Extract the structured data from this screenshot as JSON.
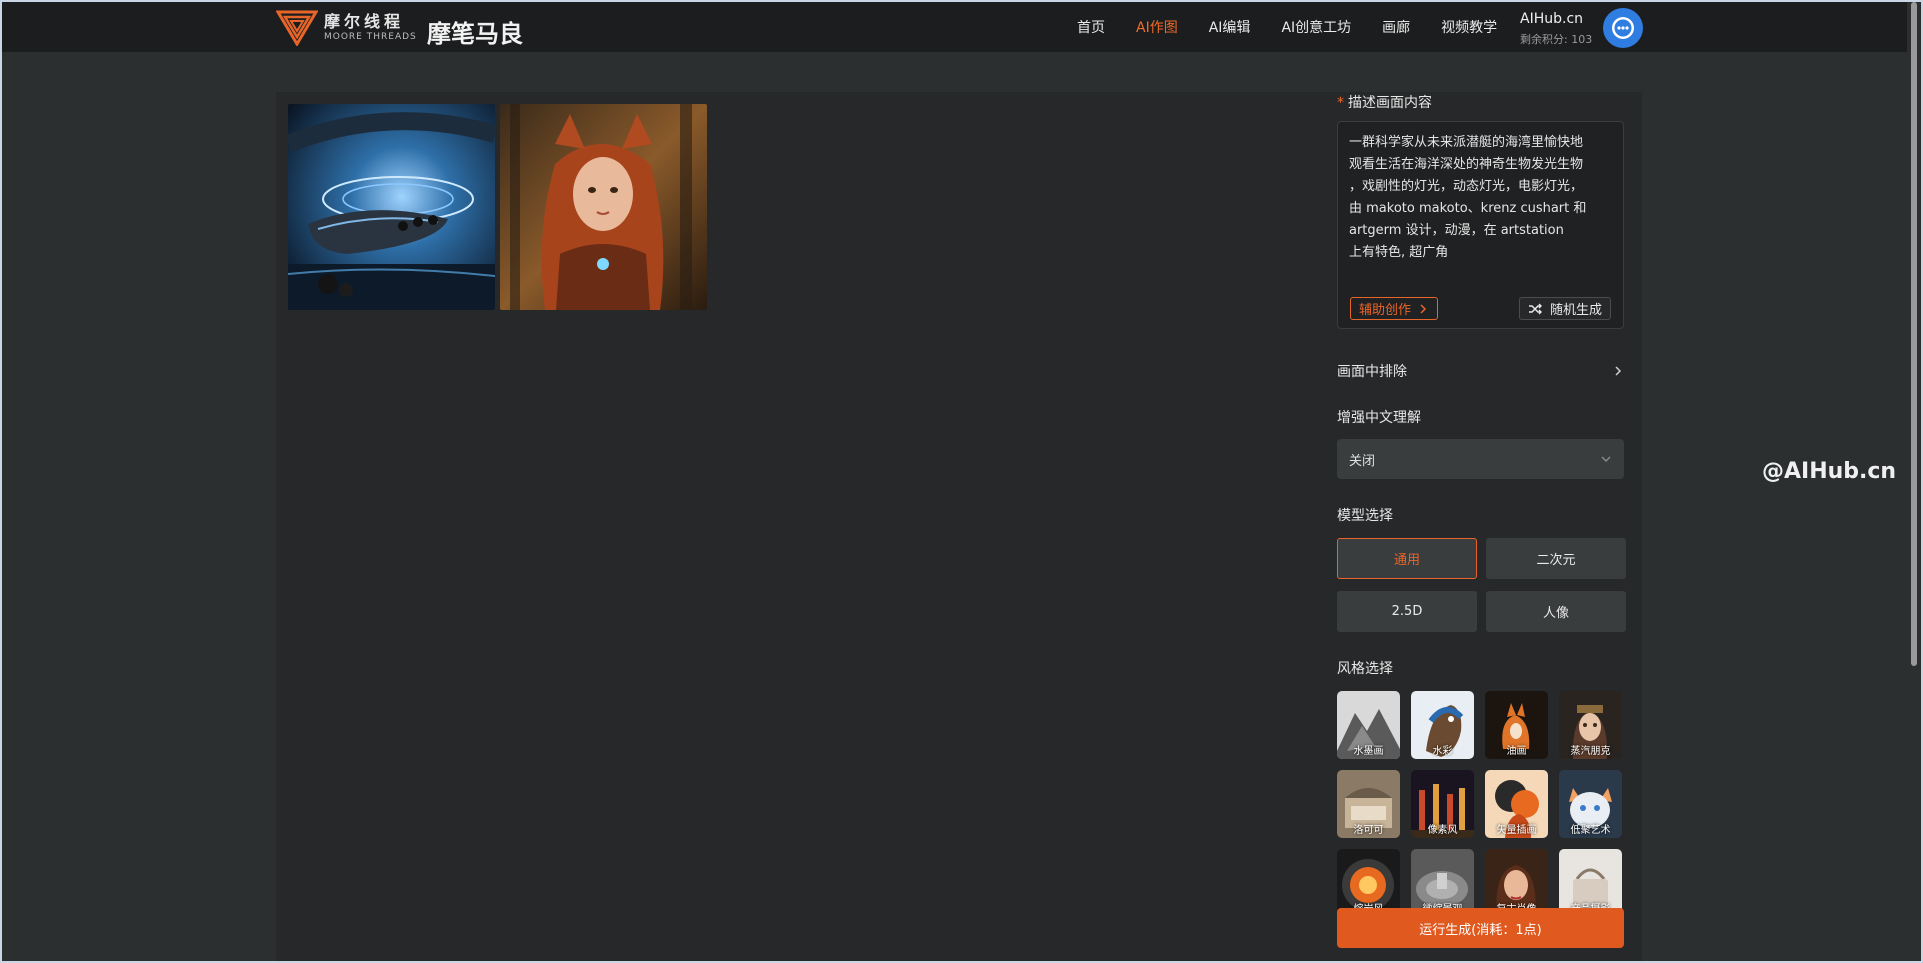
{
  "header": {
    "logo_cn": "摩尔线程",
    "logo_en": "MOORE THREADS",
    "brand_title": "摩笔马良",
    "nav": [
      "首页",
      "AI作图",
      "AI编辑",
      "AI创意工坊",
      "画廊",
      "视频教学"
    ],
    "active_nav": "AI作图",
    "user_name": "AIHub.cn",
    "points": "剩余积分: 103",
    "accent": "#f26b2a"
  },
  "gallery": {
    "images": [
      "submarine-scene",
      "fox-girl-portrait"
    ]
  },
  "panel": {
    "prompt_label": "描述画面内容",
    "prompt_required_mark": "*",
    "prompt_text": "一群科学家从未来派潜艇的海湾里愉快地\n观看生活在海洋深处的神奇生物发光生物\n，戏剧性的灯光，动态灯光，电影灯光，\n由 makoto makoto、krenz cushart 和\nartgerm 设计，动漫，在 artstation\n上有特色, 超广角",
    "assist_label": "辅助创作",
    "random_label": "随机生成",
    "exclude_label": "画面中排除",
    "enhance_label": "增强中文理解",
    "enhance_value": "关闭",
    "model_label": "模型选择",
    "models": [
      "通用",
      "二次元",
      "2.5D",
      "人像"
    ],
    "active_model": "通用",
    "style_label": "风格选择",
    "styles": [
      "水墨画",
      "水彩",
      "油画",
      "蒸汽朋克",
      "洛可可",
      "像素风",
      "矢量插画",
      "低聚艺术",
      "熔岩风",
      "微缩景观",
      "复古肖像",
      "产品摄影"
    ],
    "run_label": "运行生成(消耗：1点)"
  },
  "watermark": "@AIHub.cn"
}
